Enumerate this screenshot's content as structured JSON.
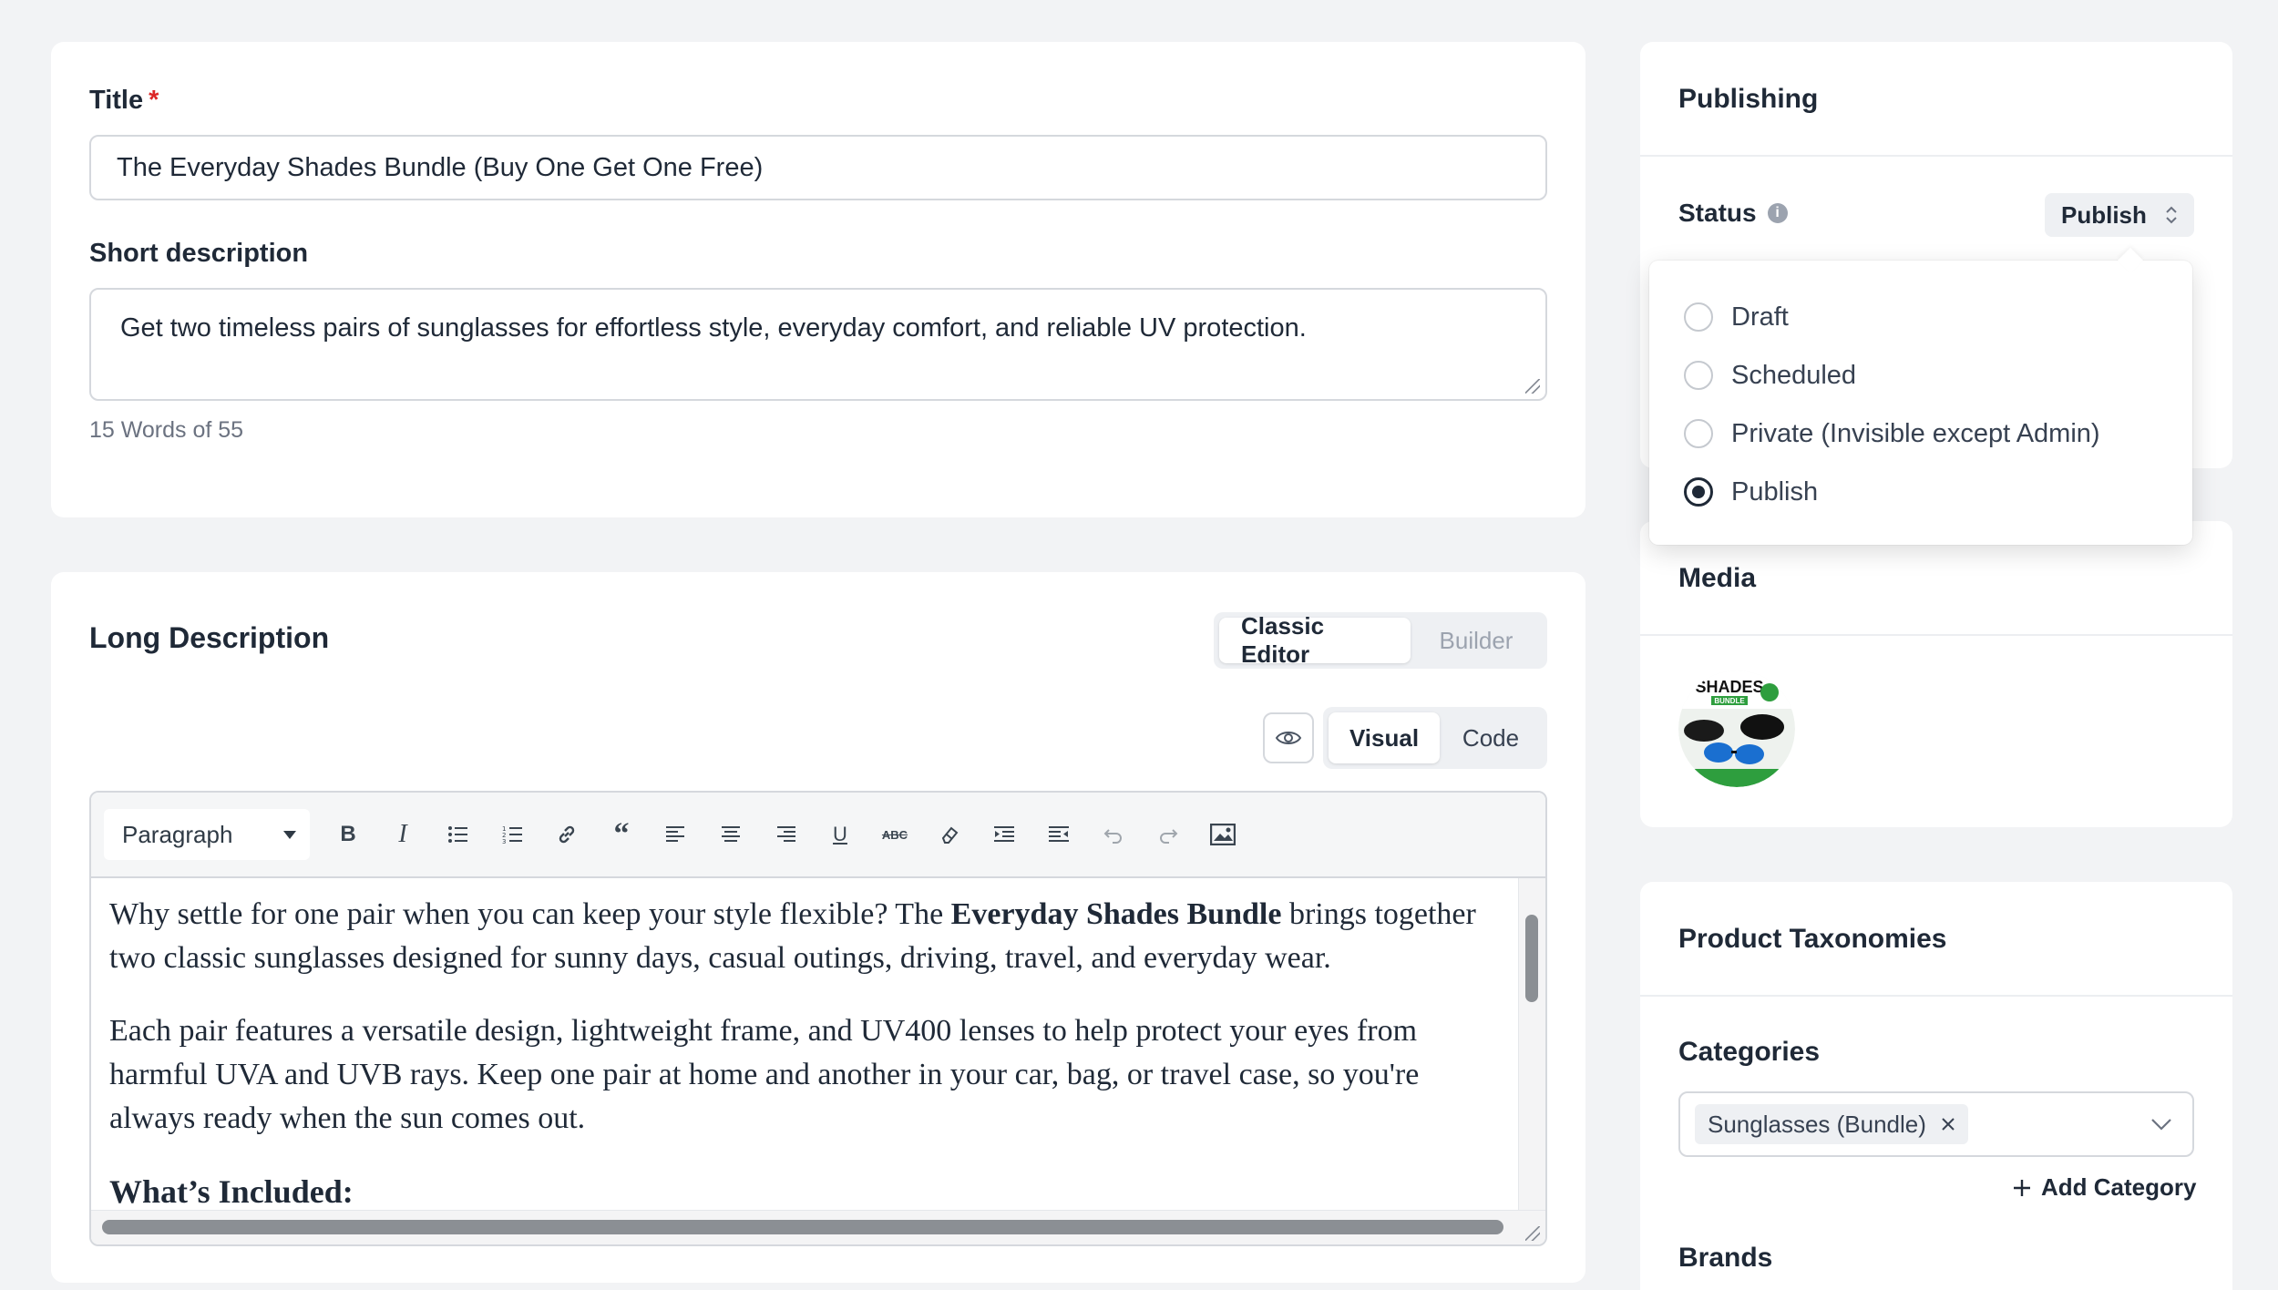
{
  "general": {
    "title_label": "Title",
    "required_mark": "*",
    "title_value": "The Everyday Shades Bundle (Buy One Get One Free)",
    "short_desc_label": "Short description",
    "short_desc_value": "Get two timeless pairs of sunglasses for effortless style, everyday comfort, and reliable UV protection.",
    "word_count": "15 Words of 55"
  },
  "long_description": {
    "title": "Long Description",
    "mode_tabs": [
      "Classic Editor",
      "Builder"
    ],
    "active_mode": "Classic Editor",
    "view_tabs": [
      "Visual",
      "Code"
    ],
    "active_view": "Visual",
    "preview_icon": "eye-icon",
    "format_select": "Paragraph",
    "toolbar_icons": [
      "bold-icon",
      "italic-icon",
      "bullet-list-icon",
      "numbered-list-icon",
      "link-icon",
      "blockquote-icon",
      "align-left-icon",
      "align-center-icon",
      "align-right-icon",
      "underline-icon",
      "strikethrough-icon",
      "clear-format-icon",
      "indent-icon",
      "outdent-icon",
      "undo-icon",
      "redo-icon",
      "image-icon"
    ],
    "content": {
      "p1_before": "Why settle for one pair when you can keep your style flexible? The ",
      "p1_bold": "Everyday Shades Bundle",
      "p1_after": " brings together two classic sunglasses designed for sunny days, casual outings, driving, travel, and everyday wear.",
      "p2": "Each pair features a versatile design, lightweight frame, and UV400 lenses to help protect your eyes from harmful UVA and UVB rays. Keep one pair at home and another in your car, bag, or travel case, so you're always ready when the sun comes out.",
      "h_included": "What’s Included:"
    }
  },
  "publishing": {
    "title": "Publishing",
    "status_label": "Status",
    "status_value": "Publish",
    "options": [
      {
        "label": "Draft",
        "checked": false
      },
      {
        "label": "Scheduled",
        "checked": false
      },
      {
        "label": "Private (Invisible except Admin)",
        "checked": false
      },
      {
        "label": "Publish",
        "checked": true
      }
    ]
  },
  "media": {
    "title": "Media",
    "thumb_text_top": "SHADES",
    "thumb_text_sub": "BUNDLE"
  },
  "taxonomies": {
    "title": "Product Taxonomies",
    "categories_label": "Categories",
    "category_tag": "Sunglasses (Bundle)",
    "add_category": "Add Category",
    "brands_label": "Brands"
  }
}
